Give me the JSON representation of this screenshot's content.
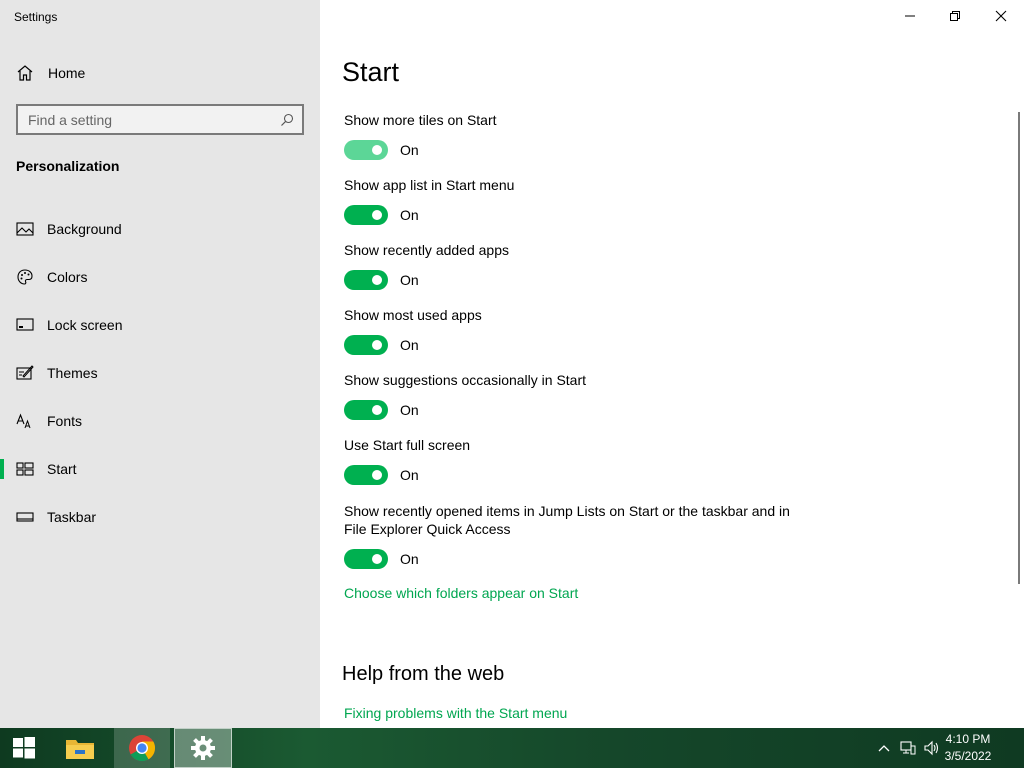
{
  "window": {
    "title": "Settings"
  },
  "sidebar": {
    "home_label": "Home",
    "search_placeholder": "Find a setting",
    "section_title": "Personalization",
    "items": [
      {
        "label": "Background",
        "icon": "picture-icon"
      },
      {
        "label": "Colors",
        "icon": "palette-icon"
      },
      {
        "label": "Lock screen",
        "icon": "lock-screen-icon"
      },
      {
        "label": "Themes",
        "icon": "themes-icon"
      },
      {
        "label": "Fonts",
        "icon": "fonts-icon"
      },
      {
        "label": "Start",
        "icon": "start-icon",
        "active": true
      },
      {
        "label": "Taskbar",
        "icon": "taskbar-icon"
      }
    ]
  },
  "main": {
    "title": "Start",
    "settings": [
      {
        "label": "Show more tiles on Start",
        "state": "On"
      },
      {
        "label": "Show app list in Start menu",
        "state": "On"
      },
      {
        "label": "Show recently added apps",
        "state": "On"
      },
      {
        "label": "Show most used apps",
        "state": "On"
      },
      {
        "label": "Show suggestions occasionally in Start",
        "state": "On"
      },
      {
        "label": "Use Start full screen",
        "state": "On"
      },
      {
        "label": "Show recently opened items in Jump Lists on Start or the taskbar and in File Explorer Quick Access",
        "state": "On"
      }
    ],
    "folders_link": "Choose which folders appear on Start",
    "help_heading": "Help from the web",
    "help_link": "Fixing problems with the Start menu"
  },
  "taskbar": {
    "time": "4:10 PM",
    "date": "3/5/2022"
  },
  "colors": {
    "accent": "#00b050",
    "link": "#00a650",
    "sidebar_bg": "#e6e6e6"
  }
}
